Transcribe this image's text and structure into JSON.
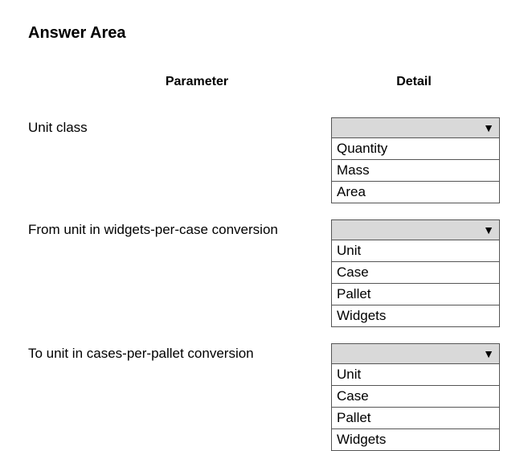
{
  "title": "Answer Area",
  "headers": {
    "parameter": "Parameter",
    "detail": "Detail"
  },
  "rows": [
    {
      "label": "Unit class",
      "options": [
        "Quantity",
        "Mass",
        "Area"
      ]
    },
    {
      "label": "From unit in widgets-per-case conversion",
      "options": [
        "Unit",
        "Case",
        "Pallet",
        "Widgets"
      ]
    },
    {
      "label": "To unit in cases-per-pallet conversion",
      "options": [
        "Unit",
        "Case",
        "Pallet",
        "Widgets"
      ]
    }
  ]
}
